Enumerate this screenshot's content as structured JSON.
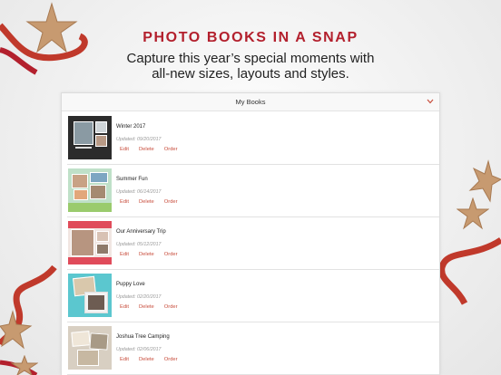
{
  "hero": {
    "title": "PHOTO BOOKS IN A SNAP",
    "subtitle_line1": "Capture this year’s special moments with",
    "subtitle_line2": "all-new sizes, layouts and styles."
  },
  "panel": {
    "title": "My Books",
    "chevron_icon": "chevron-down-icon"
  },
  "actions": {
    "edit": "Edit",
    "delete": "Delete",
    "order": "Order"
  },
  "books": [
    {
      "title": "Winter 2017",
      "updated": "Updated: 09/20/2017"
    },
    {
      "title": "Summer Fun",
      "updated": "Updated: 06/14/2017"
    },
    {
      "title": "Our Anniversary Trip",
      "updated": "Updated: 05/12/2017"
    },
    {
      "title": "Puppy Love",
      "updated": "Updated: 02/20/2017"
    },
    {
      "title": "Joshua Tree Camping",
      "updated": "Updated: 02/06/2017"
    }
  ],
  "colors": {
    "accent": "#b3202d",
    "link": "#c84d3c",
    "ribbon": "#c0392b",
    "star": "#c79a70"
  }
}
